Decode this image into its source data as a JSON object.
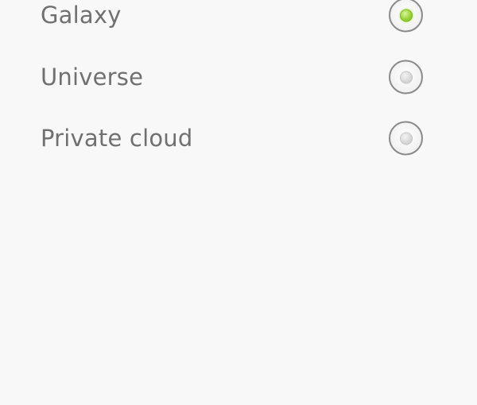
{
  "options": [
    {
      "label": "Galaxy",
      "selected": true
    },
    {
      "label": "Universe",
      "selected": false
    },
    {
      "label": "Private cloud",
      "selected": false
    }
  ],
  "colors": {
    "background": "#f8f8f8",
    "label_text": "#707070",
    "radio_border": "#8a8a8a",
    "selected_dot": "#8cc832",
    "unselected_dot": "#d6d6d6"
  }
}
